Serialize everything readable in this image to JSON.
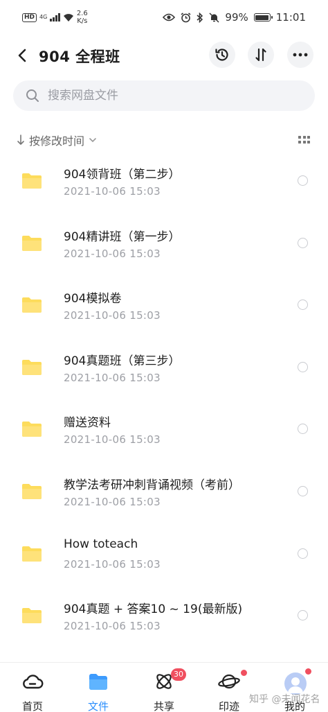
{
  "status_bar": {
    "hd": "HD",
    "network": "4G",
    "speed_value": "2.6",
    "speed_unit": "K/s",
    "battery": "99%",
    "time": "11:01"
  },
  "header": {
    "title": "904  全程班"
  },
  "search": {
    "placeholder": "搜索网盘文件"
  },
  "sort": {
    "label": "按修改时间"
  },
  "files": [
    {
      "name": "904领背班（第二步）",
      "date": "2021-10-06  15:03"
    },
    {
      "name": "904精讲班（第一步）",
      "date": "2021-10-06  15:03"
    },
    {
      "name": "904模拟卷",
      "date": "2021-10-06  15:03"
    },
    {
      "name": "904真题班（第三步）",
      "date": "2021-10-06  15:03"
    },
    {
      "name": "赠送资料",
      "date": "2021-10-06  15:03"
    },
    {
      "name": "教学法考研冲刺背诵视频（考前）",
      "date": "2021-10-06  15:03"
    },
    {
      "name": "How toteach",
      "date": "2021-10-06  15:03"
    },
    {
      "name": "904真题 + 答案10 ~ 19(最新版)",
      "date": "2021-10-06  15:03"
    }
  ],
  "bottom_nav": {
    "home": "首页",
    "files": "文件",
    "share": "共享",
    "share_badge": "30",
    "trail": "印迹",
    "mine": "我的"
  },
  "watermark": "知乎 @未闻花名",
  "colors": {
    "accent": "#2b8efc",
    "folder": "#fddc5c",
    "badge": "#f04f5f"
  }
}
